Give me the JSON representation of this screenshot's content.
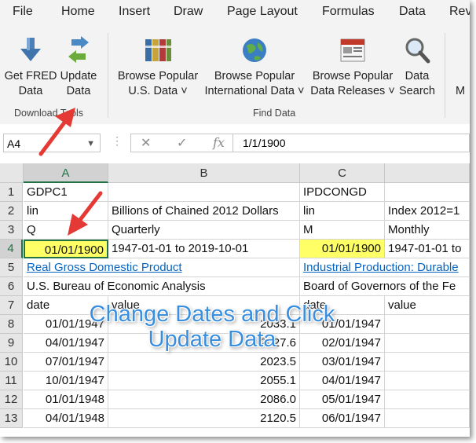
{
  "menu": {
    "tabs": [
      "File",
      "Home",
      "Insert",
      "Draw",
      "Page Layout",
      "Formulas",
      "Data",
      "Rev"
    ]
  },
  "ribbon": {
    "get_fred_data": "Get FRED\nData",
    "get_fred_line1": "Get FRED",
    "get_fred_line2": "Data",
    "update_line1": "Update",
    "update_line2": "Data",
    "browse_us_line1": "Browse Popular",
    "browse_us_line2": "U.S. Data ˅",
    "browse_intl_line1": "Browse Popular",
    "browse_intl_line2": "International Data ˅",
    "browse_rel_line1": "Browse Popular",
    "browse_rel_line2": "Data Releases ˅",
    "search_line1": "Data",
    "search_line2": "Search",
    "cut_m": "M",
    "group_download": "Download Tools",
    "group_find": "Find Data"
  },
  "formula_bar": {
    "name_box": "A4",
    "value": "1/1/1900"
  },
  "columns": [
    "A",
    "B",
    "C"
  ],
  "rows": [
    {
      "num": "1",
      "a": "GDPC1",
      "b": "",
      "c": "IPDCONGD",
      "d": ""
    },
    {
      "num": "2",
      "a": "lin",
      "b": "Billions of Chained 2012 Dollars",
      "c": "lin",
      "d": "Index 2012=1"
    },
    {
      "num": "3",
      "a": "Q",
      "b": "Quarterly",
      "c": "M",
      "d": "Monthly"
    },
    {
      "num": "4",
      "a": "01/01/1900",
      "b": "1947-01-01 to 2019-10-01",
      "c": "01/01/1900",
      "d": "1947-01-01 to"
    },
    {
      "num": "5",
      "a": "Real Gross Domestic Product",
      "b": "",
      "c": "Industrial Production: Durable",
      "d": ""
    },
    {
      "num": "6",
      "a": "U.S. Bureau of Economic Analysis",
      "b": "",
      "c": "Board of Governors of the Fe",
      "d": ""
    },
    {
      "num": "7",
      "a": "date",
      "b": "value",
      "c": "date",
      "d": "value"
    },
    {
      "num": "8",
      "a": "01/01/1947",
      "b": "2033.1",
      "c": "01/01/1947",
      "d": ""
    },
    {
      "num": "9",
      "a": "04/01/1947",
      "b": "2027.6",
      "c": "02/01/1947",
      "d": ""
    },
    {
      "num": "10",
      "a": "07/01/1947",
      "b": "2023.5",
      "c": "03/01/1947",
      "d": ""
    },
    {
      "num": "11",
      "a": "10/01/1947",
      "b": "2055.1",
      "c": "04/01/1947",
      "d": ""
    },
    {
      "num": "12",
      "a": "01/01/1948",
      "b": "2086.0",
      "c": "05/01/1947",
      "d": ""
    },
    {
      "num": "13",
      "a": "04/01/1948",
      "b": "2120.5",
      "c": "06/01/1947",
      "d": ""
    }
  ],
  "annotation": {
    "line1": "Change Dates and Click",
    "line2": "Update Data"
  },
  "colors": {
    "highlight": "#ffff66",
    "arrow": "#e53935",
    "annotation": "#3a8ede",
    "link": "#0563c1",
    "excel_green": "#217346"
  }
}
